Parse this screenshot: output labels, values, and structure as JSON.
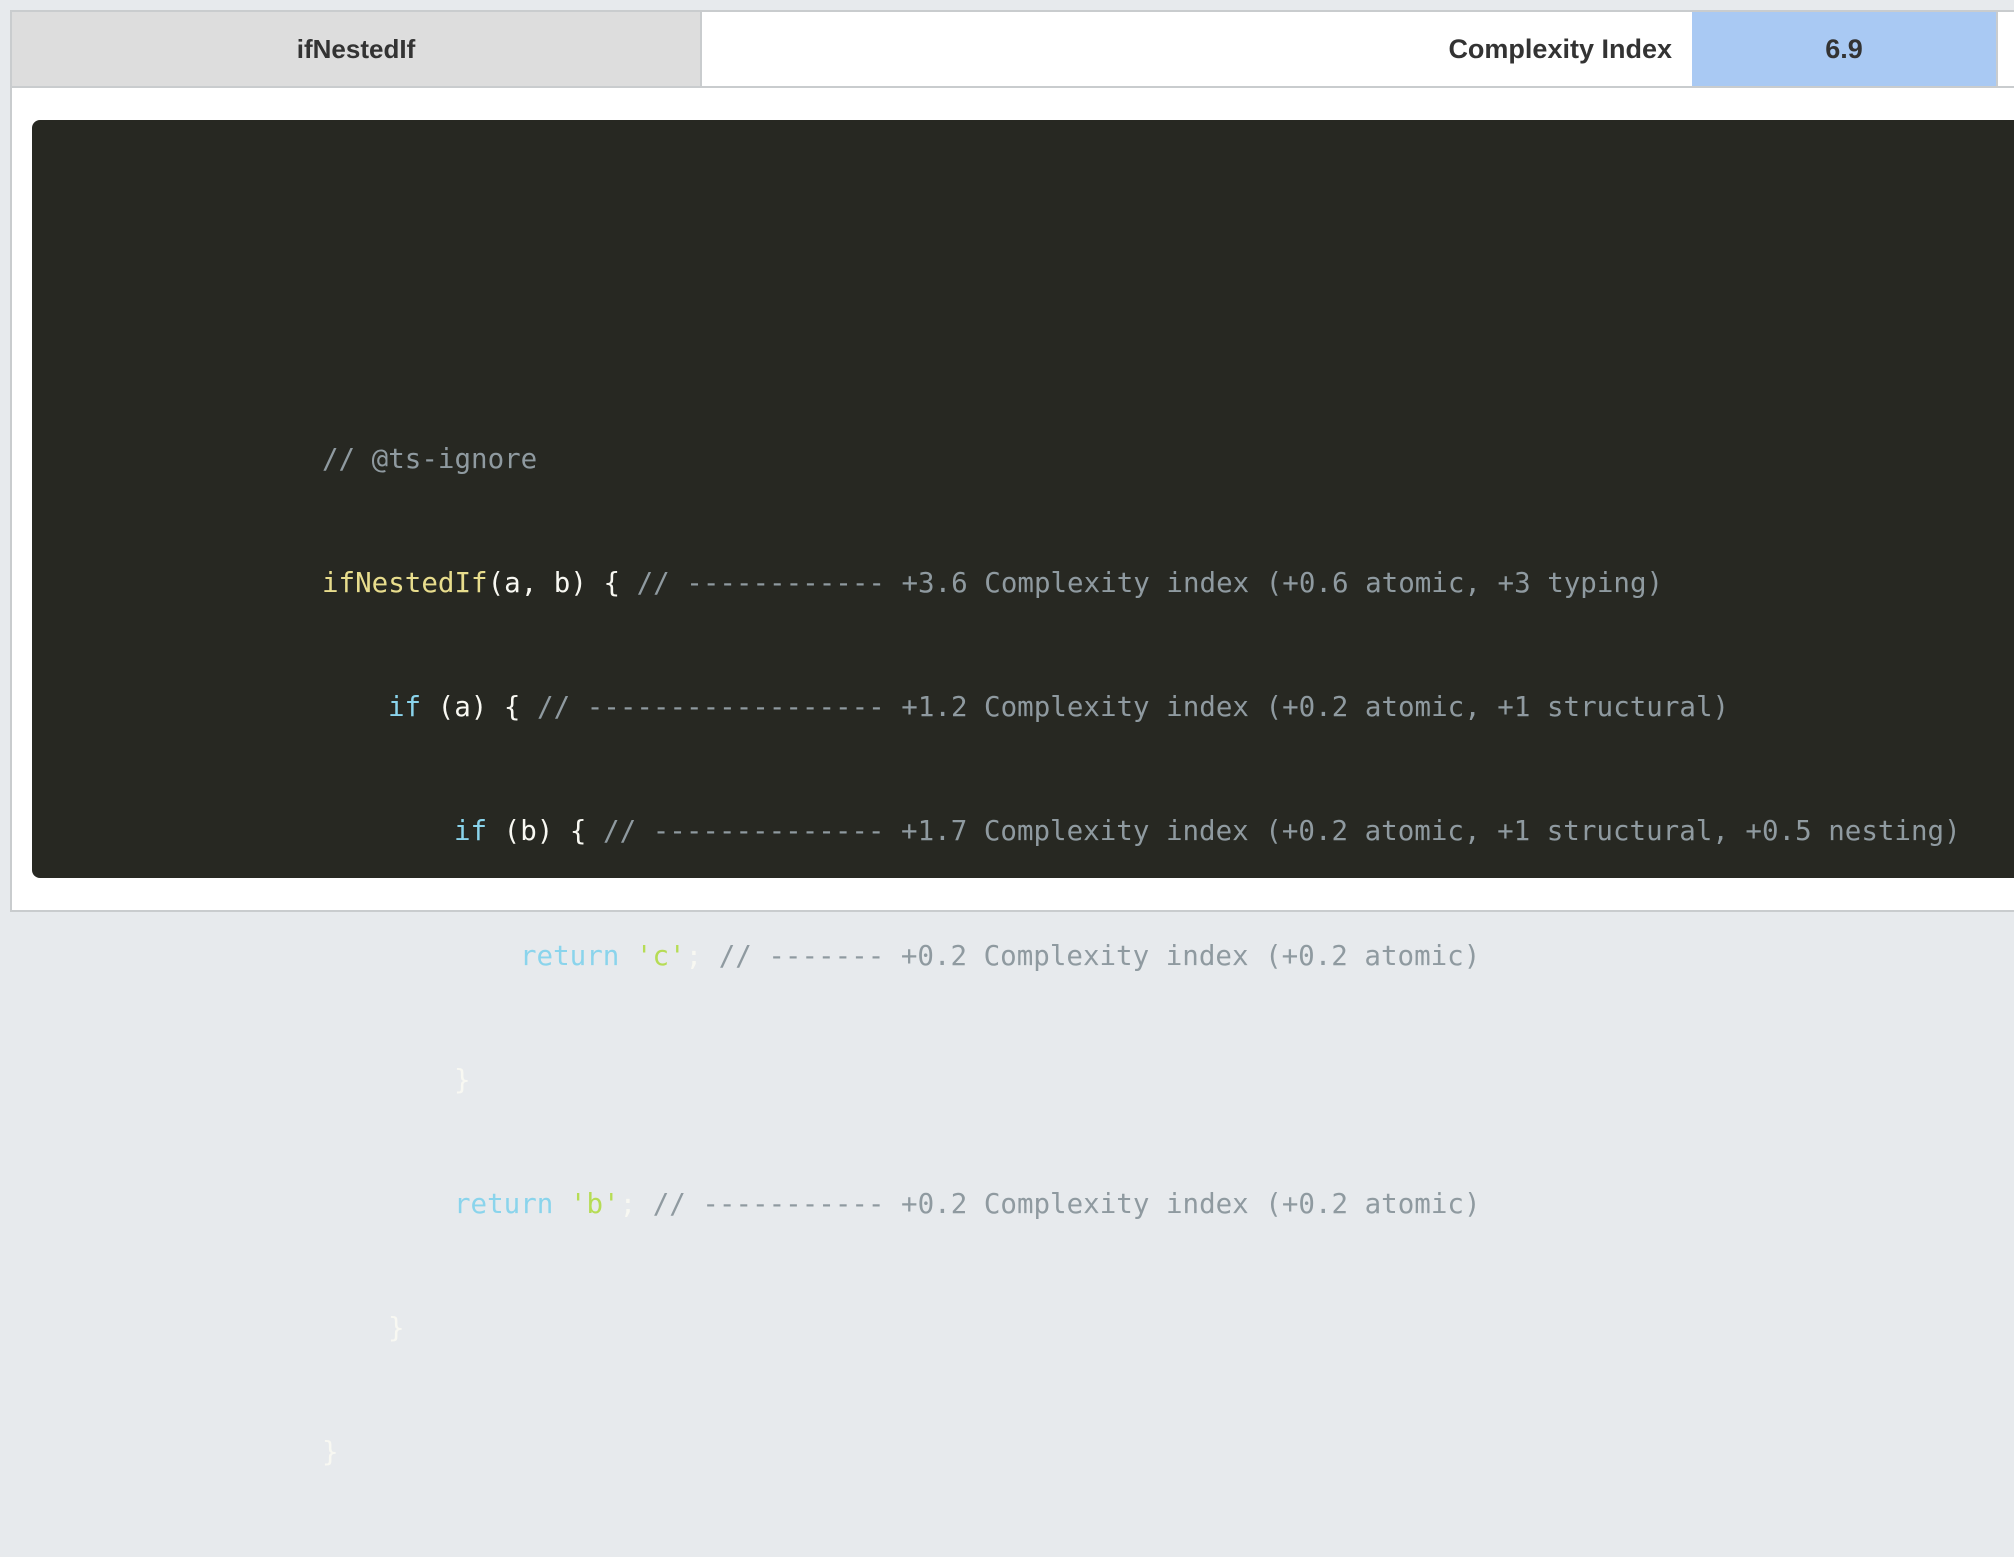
{
  "header": {
    "function_name": "ifNestedIf",
    "metric_label": "Complexity Index",
    "metric_value": "6.9"
  },
  "code": {
    "line1": {
      "comment": "// @ts-ignore"
    },
    "line2": {
      "fn": "ifNestedIf",
      "rest": "(a, b) { ",
      "comment": "// ------------ +3.6 Complexity index (+0.6 atomic, +3 typing)"
    },
    "line3": {
      "kw": "if",
      "rest": " (a) { ",
      "comment": "// ------------------ +1.2 Complexity index (+0.2 atomic, +1 structural)"
    },
    "line4": {
      "kw": "if",
      "rest": " (b) { ",
      "comment": "// -------------- +1.7 Complexity index (+0.2 atomic, +1 structural, +0.5 nesting)"
    },
    "line5": {
      "kw": "return",
      "str": "'c'",
      "rest": "; ",
      "comment": "// ------- +0.2 Complexity index (+0.2 atomic)"
    },
    "line6": {
      "rest": "}"
    },
    "line7": {
      "kw": "return",
      "str": "'b'",
      "rest": "; ",
      "comment": "// ----------- +0.2 Complexity index (+0.2 atomic)"
    },
    "line8": {
      "rest": "}"
    },
    "line9": {
      "rest": "}"
    }
  },
  "colors": {
    "code_background": "#272822",
    "metric_highlight": "#a9c9f3",
    "name_cell": "#dddddd"
  }
}
